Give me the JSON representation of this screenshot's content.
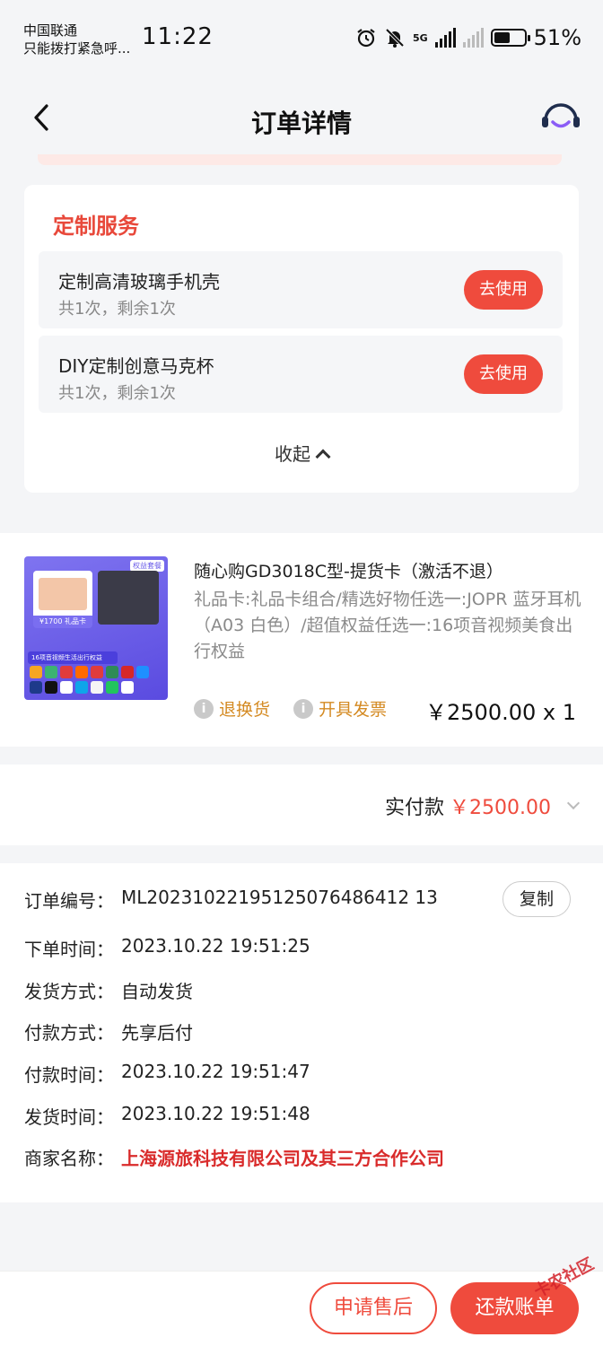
{
  "status_bar": {
    "carrier_line1": "中国联通",
    "carrier_line2": "只能拨打紧急呼...",
    "time": "11:22",
    "network": "5G",
    "battery": "51%"
  },
  "header": {
    "title": "订单详情",
    "back_icon": "chevron-left-icon",
    "service_icon": "customer-service-icon"
  },
  "custom_service": {
    "title": "定制服务",
    "items": [
      {
        "name": "定制高清玻璃手机壳",
        "usage": "共1次，剩余1次",
        "button": "去使用"
      },
      {
        "name": "DIY定制创意马克杯",
        "usage": "共1次，剩余1次",
        "button": "去使用"
      }
    ],
    "collapse_label": "收起"
  },
  "product": {
    "title": "随心购GD3018C型-提货卡（激活不退）",
    "description": "礼品卡:礼品卡组合/精选好物任选一:JOPR 蓝牙耳机（A03 白色）/超值权益任选一:16项音视频美食出行权益",
    "return_label": "退换货",
    "invoice_label": "开具发票",
    "price_qty": "￥2500.00 x 1",
    "thumb_tag": "权益套餐",
    "thumb_price": "¥1700 礼品卡",
    "thumb_ribbon": "16项音视频生活出行权益"
  },
  "payment": {
    "label": "实付款",
    "amount": "￥2500.00"
  },
  "order_info": {
    "rows": [
      {
        "key": "订单编号：",
        "value": "ML20231022195125076486412 13"
      },
      {
        "key": "下单时间：",
        "value": "2023.10.22 19:51:25"
      },
      {
        "key": "发货方式：",
        "value": "自动发货"
      },
      {
        "key": "付款方式：",
        "value": "先享后付"
      },
      {
        "key": "付款时间：",
        "value": "2023.10.22 19:51:47"
      },
      {
        "key": "发货时间：",
        "value": "2023.10.22 19:51:48"
      },
      {
        "key": "商家名称：",
        "value": "上海源旅科技有限公司及其三方合作公司"
      }
    ],
    "copy_label": "复制"
  },
  "bottom_bar": {
    "after_sales": "申请售后",
    "repay": "还款账单"
  },
  "watermark": "卡农社区",
  "colors": {
    "accent": "#ef4b3d",
    "merchant_red": "#d92b2b",
    "link_orange": "#d48a22"
  }
}
